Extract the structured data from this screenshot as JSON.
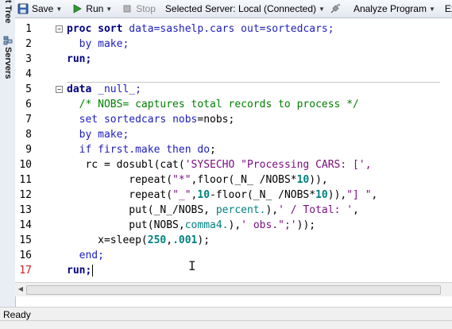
{
  "side_panel": {
    "tabs": [
      {
        "label": "t Tree",
        "icon": "tree-icon"
      },
      {
        "label": "Servers",
        "icon": "servers-icon"
      }
    ]
  },
  "toolbar": {
    "save_label": "Save",
    "run_label": "Run",
    "stop_label": "Stop",
    "server_label": "Selected Server: Local (Connected)",
    "analyze_label": "Analyze Program",
    "export_label": "Ex"
  },
  "editor": {
    "line_numbers": [
      "1",
      "2",
      "3",
      "4",
      "5",
      "6",
      "7",
      "8",
      "9",
      "10",
      "11",
      "12",
      "13",
      "14",
      "15",
      "16",
      "17"
    ],
    "fold_markers": {
      "line_1": "−",
      "line_5": "−"
    },
    "lines": {
      "l1_kw": "proc sort",
      "l1_rest": " data=sashelp.cars out=sortedcars;",
      "l2": "  by make;",
      "l3": "run;",
      "l4": "",
      "l5_kw": "data",
      "l5_rest": " _null_;",
      "l6_com": "  /* NOBS= captures total records to process */",
      "l7_a": "  set sortedcars ",
      "l7_b": "nobs",
      "l7_c": "=nobs;",
      "l8": "  by make;",
      "l9_a": "  if first.make ",
      "l9_b": "then do",
      "l9_c": ";",
      "l10_a": "   rc = dosubl(cat(",
      "l10_str": "'SYSECHO \"Processing CARS: [',",
      "l11_a": "          repeat(",
      "l11_str": "\"*\"",
      "l11_b": ",floor(_N_ /NOBS*",
      "l11_num": "10",
      "l11_c": ")),",
      "l12_a": "          repeat(",
      "l12_str": "\"_\"",
      "l12_b": ",",
      "l12_num": "10",
      "l12_c": "-floor(_N_ /NOBS*",
      "l12_num2": "10",
      "l12_d": ")),",
      "l12_str2": "\"] \"",
      "l12_e": ",",
      "l13_a": "          put(_N_/NOBS, ",
      "l13_fmt": "percent.",
      "l13_b": "),",
      "l13_str": "' / Total: '",
      "l13_c": ",",
      "l14_a": "          put(NOBS,",
      "l14_fmt": "comma4.",
      "l14_b": "),",
      "l14_str": "' obs.\";'",
      "l14_c": "));",
      "l15_a": "     x=sleep(",
      "l15_num": "250",
      "l15_b": ",",
      "l15_num2": ".001",
      "l15_c": ");",
      "l16": "  end;",
      "l17": "run;"
    }
  },
  "statusbar": {
    "text": "Ready"
  }
}
